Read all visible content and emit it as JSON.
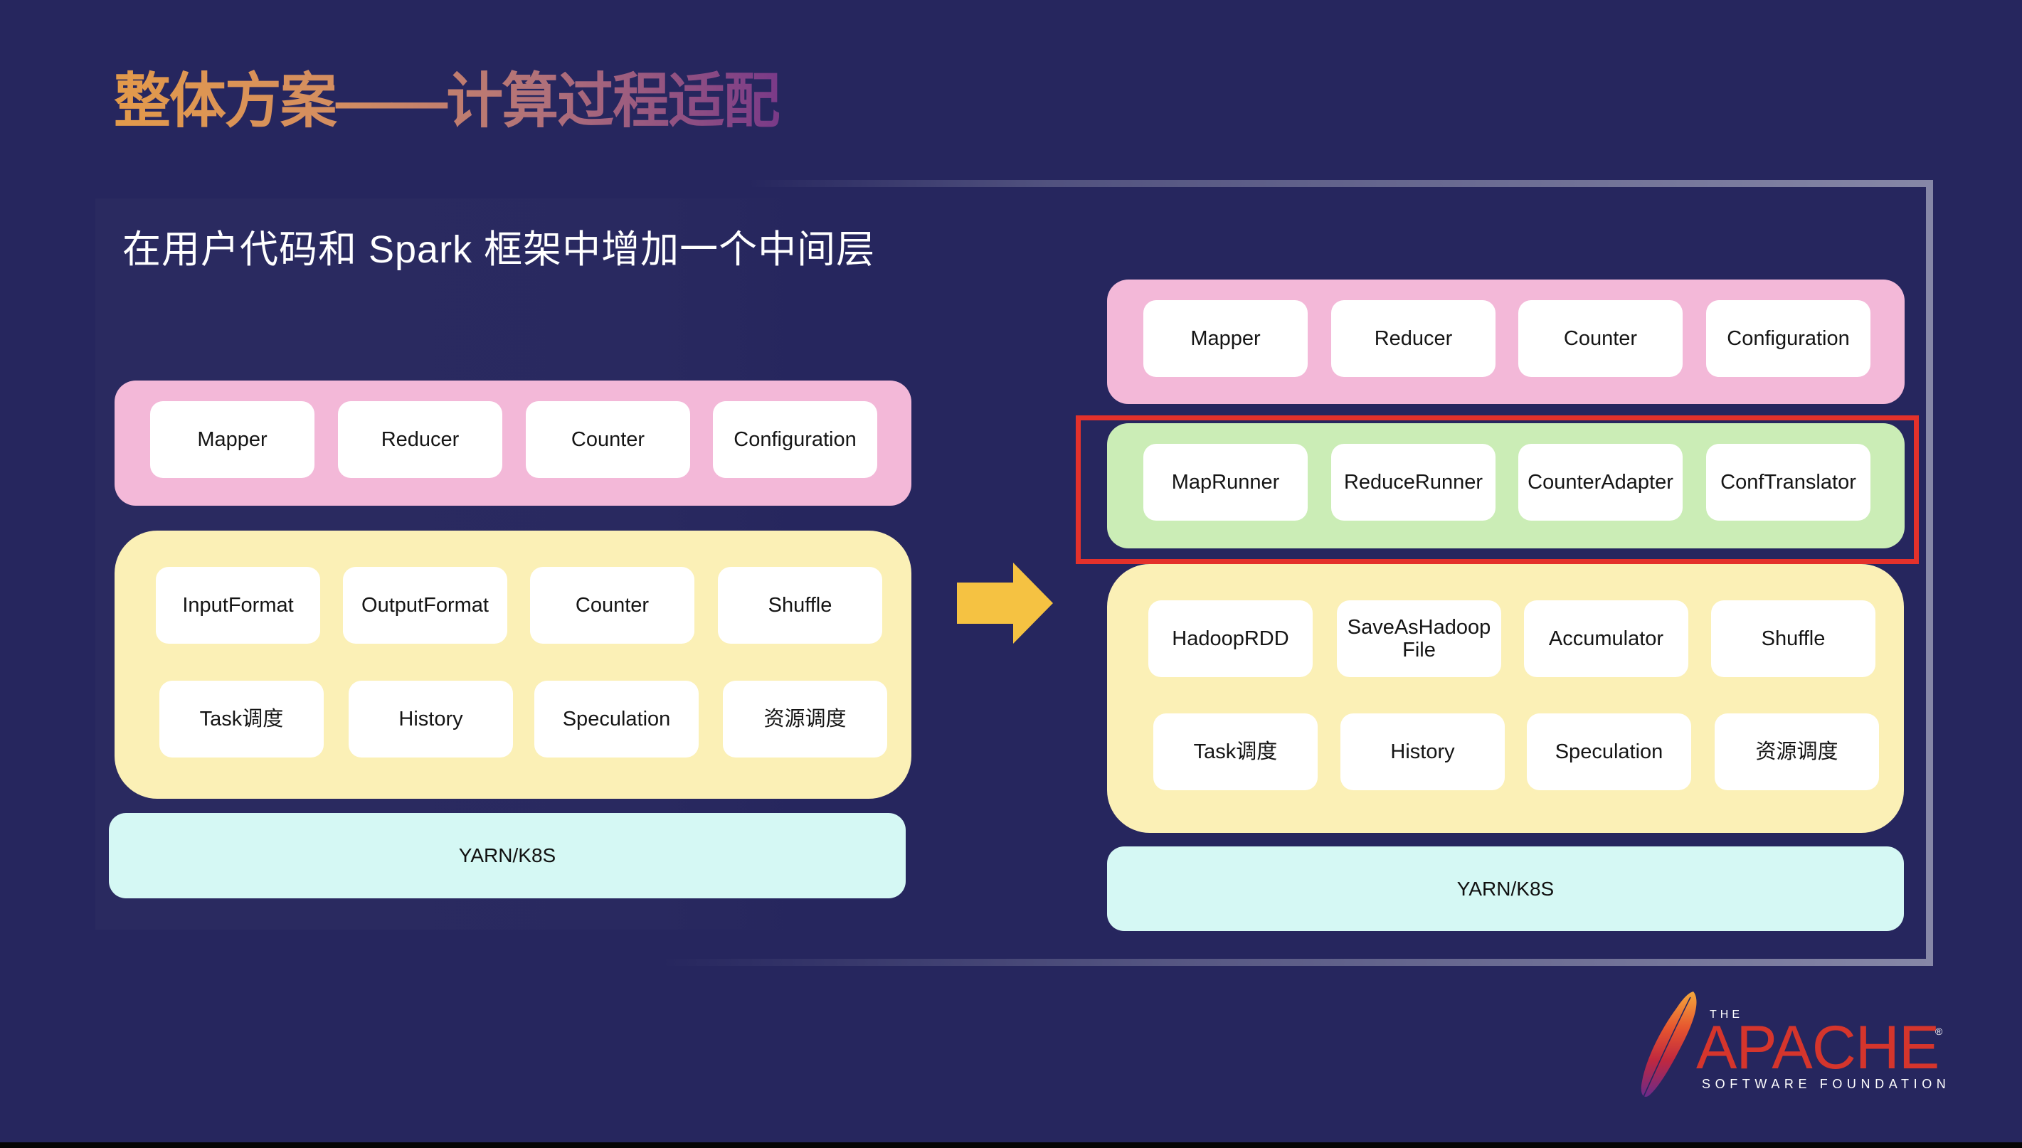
{
  "slide": {
    "title": "整体方案——计算过程适配",
    "subtitle": "在用户代码和 Spark 框架中增加一个中间层",
    "colors": {
      "background": "#26265e",
      "title_gradient_start": "#e39a4a",
      "title_gradient_end": "#7a3a88",
      "user_layer": "#f3b8d8",
      "adapter_layer": "#cbedb6",
      "framework_layer": "#fbf0b6",
      "resource_layer": "#d5f8f4",
      "highlight_border": "#e4312b",
      "arrow": "#f5c242"
    }
  },
  "left_stack": {
    "user_layer": [
      "Mapper",
      "Reducer",
      "Counter",
      "Configuration"
    ],
    "framework_layer": {
      "row1": [
        "InputFormat",
        "OutputFormat",
        "Counter",
        "Shuffle"
      ],
      "row2": [
        "Task调度",
        "History",
        "Speculation",
        "资源调度"
      ]
    },
    "resource_layer": "YARN/K8S"
  },
  "transition_arrow": "arrow-right-icon",
  "right_stack": {
    "user_layer": [
      "Mapper",
      "Reducer",
      "Counter",
      "Configuration"
    ],
    "adapter_layer": [
      "MapRunner",
      "ReduceRunner",
      "CounterAdapter",
      "ConfTranslator"
    ],
    "framework_layer": {
      "row1": [
        "HadoopRDD",
        "SaveAsHadoop File",
        "Accumulator",
        "Shuffle"
      ],
      "row2": [
        "Task调度",
        "History",
        "Speculation",
        "资源调度"
      ]
    },
    "resource_layer": "YARN/K8S"
  },
  "logo": {
    "icon": "apache-feather-icon",
    "the": "THE",
    "name": "APACHE",
    "registered": "®",
    "tagline": "SOFTWARE FOUNDATION"
  }
}
